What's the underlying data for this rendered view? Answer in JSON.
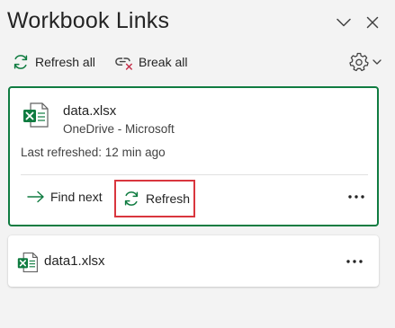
{
  "header": {
    "title": "Workbook Links"
  },
  "toolbar": {
    "refresh_all_label": "Refresh all",
    "break_all_label": "Break all"
  },
  "links": [
    {
      "file_name": "data.xlsx",
      "location": "OneDrive - Microsoft",
      "last_refreshed": "Last refreshed: 12 min ago",
      "find_next_label": "Find next",
      "refresh_label": "Refresh",
      "selected": true
    },
    {
      "file_name": "data1.xlsx"
    }
  ],
  "colors": {
    "accent_green": "#107c41",
    "highlight_red": "#d9363e",
    "break_red": "#c4314b",
    "icon_gray": "#424242"
  },
  "icons": {
    "collapse": "chevron-down-icon",
    "close": "close-icon",
    "refresh_all": "refresh-icon",
    "break_all": "broken-link-icon",
    "settings": "gear-icon",
    "excel": "excel-file-icon",
    "find_next": "arrow-right-icon",
    "more": "more-options-icon"
  }
}
